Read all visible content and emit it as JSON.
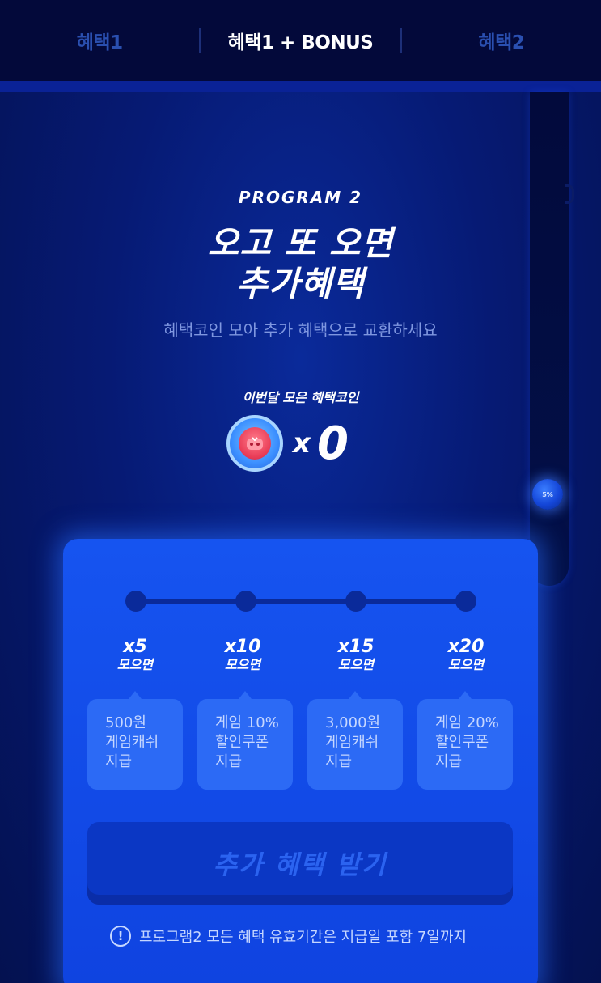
{
  "tabs": [
    {
      "label": "혜택1"
    },
    {
      "label": "혜택1 + BONUS"
    },
    {
      "label": "혜택2"
    }
  ],
  "active_tab": "혜택1 + BONUS",
  "header": {
    "program_label": "PROGRAM 2",
    "headline_line1": "오고 또 오면",
    "headline_line2": "추가혜택",
    "subtitle": "혜택코인 모아 추가 혜택으로 교환하세요"
  },
  "coins": {
    "label": "이번달 모은 혜택코인",
    "multiplier_symbol": "x",
    "count": "0"
  },
  "side_orb": {
    "label": "5%"
  },
  "steps": [
    {
      "mult": "x5",
      "collect": "모으면",
      "reward_line1": "500원",
      "reward_line2": "게임캐쉬",
      "reward_line3": "지급"
    },
    {
      "mult": "x10",
      "collect": "모으면",
      "reward_line1": "게임 10%",
      "reward_line2": "할인쿠폰",
      "reward_line3": "지급"
    },
    {
      "mult": "x15",
      "collect": "모으면",
      "reward_line1": "3,000원",
      "reward_line2": "게임캐쉬",
      "reward_line3": "지급"
    },
    {
      "mult": "x20",
      "collect": "모으면",
      "reward_line1": "게임 20%",
      "reward_line2": "할인쿠폰",
      "reward_line3": "지급"
    }
  ],
  "claim_button": {
    "label": "추가 혜택 받기"
  },
  "notice": {
    "icon": "!",
    "text": "프로그램2 모든 혜택 유효기간은 지급일 포함 7일까지"
  },
  "colors": {
    "background": "#041150",
    "card": "#1654f0",
    "reward_box": "#2c6af5",
    "button_disabled": "#0b37c4",
    "tab_inactive": "#2a4fb0"
  }
}
